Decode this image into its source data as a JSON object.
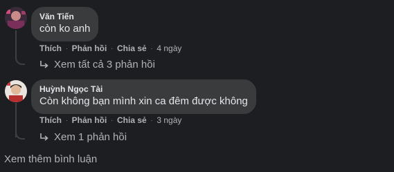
{
  "comments": [
    {
      "author": "Văn Tiến",
      "text": "còn ko anh",
      "like_label": "Thích",
      "reply_label": "Phản hồi",
      "share_label": "Chia sẻ",
      "time": "4 ngày",
      "replies_label": "Xem tất cả 3 phản hồi"
    },
    {
      "author": "Huỳnh Ngọc Tài",
      "text": "Còn không bạn mình xin ca đêm được không",
      "like_label": "Thích",
      "reply_label": "Phản hồi",
      "share_label": "Chia sẻ",
      "time": "3 ngày",
      "replies_label": "Xem 1 phản hồi"
    }
  ],
  "more_comments_label": "Xem thêm bình luận",
  "colors": {
    "background": "#1c1e21",
    "bubble": "#3a3b3c",
    "text": "#e4e6eb",
    "secondary": "#b0b3b8",
    "thread_line": "#3e4042"
  }
}
